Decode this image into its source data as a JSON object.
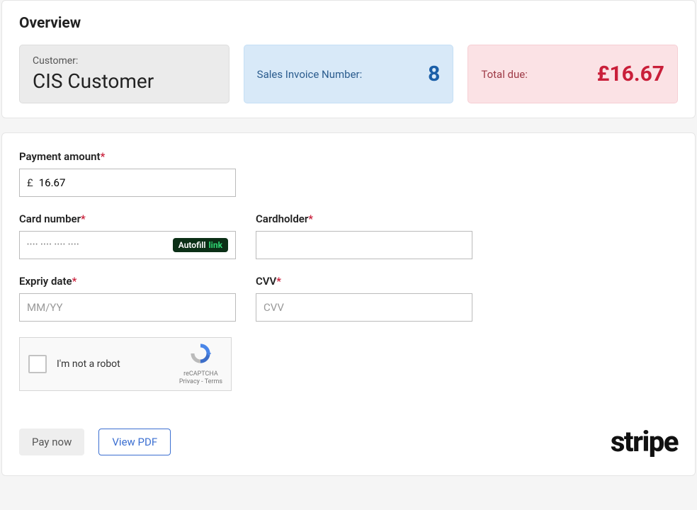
{
  "overview": {
    "title": "Overview",
    "customer_label": "Customer:",
    "customer_value": "CIS Customer",
    "invoice_label": "Sales Invoice Number:",
    "invoice_value": "8",
    "total_label": "Total due:",
    "total_value": "£16.67"
  },
  "form": {
    "amount_label": "Payment amount",
    "currency_symbol": "£",
    "amount_value": "16.67",
    "card_number_label": "Card number",
    "card_number_placeholder": "•••• •••• •••• ••••",
    "autofill_text": "Autofill",
    "autofill_link": "link",
    "cardholder_label": "Cardholder",
    "expiry_label": "Expriy date",
    "expiry_placeholder": "MM/YY",
    "cvv_label": "CVV",
    "cvv_placeholder": "CVV",
    "required_mark": "*"
  },
  "recaptcha": {
    "label": "I'm not a robot",
    "brand": "reCAPTCHA",
    "privacy": "Privacy",
    "terms": "Terms"
  },
  "buttons": {
    "pay_now": "Pay now",
    "view_pdf": "View PDF"
  },
  "footer": {
    "stripe": "stripe"
  }
}
